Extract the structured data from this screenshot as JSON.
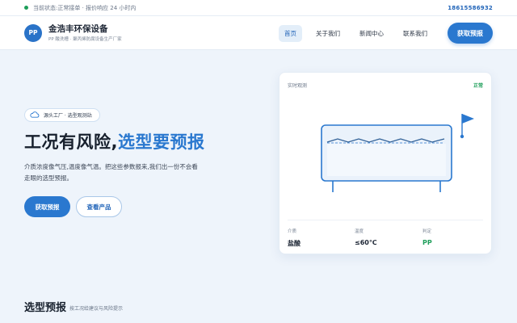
{
  "topbar": {
    "status": "当前状态:正常接单 · 报价响应 24 小时内",
    "phone": "18615586932"
  },
  "brand": {
    "logo": "PP",
    "name": "金浩丰环保设备",
    "subtitle": "PP 酸洗槽 · 聚丙烯防腐设备生产厂家"
  },
  "nav": {
    "items": [
      "首页",
      "关于我们",
      "新闻中心",
      "联系我们"
    ],
    "active": "首页",
    "cta": "获取预报"
  },
  "hero": {
    "tag": "源头工厂 · 选型观测站",
    "title_part1": "工况有风险,",
    "title_part2": "选型要预报",
    "desc": "介质浓度像气压,温度像气温。把这些参数报来,我们出一份不会看走眼的选型预报。",
    "btn_primary": "获取预报",
    "btn_secondary": "查看产品"
  },
  "card": {
    "label": "实时观测",
    "status": "正常",
    "stats": [
      {
        "label": "介质",
        "value": "盐酸"
      },
      {
        "label": "温度",
        "value": "≤60℃"
      },
      {
        "label": "判定",
        "value": "PP"
      }
    ],
    "colors": {
      "accent": "#2a78cf",
      "ok": "#1e9e5a"
    }
  },
  "section": {
    "title": "选型预报",
    "subtitle": "按工况给建议与风险提示"
  }
}
